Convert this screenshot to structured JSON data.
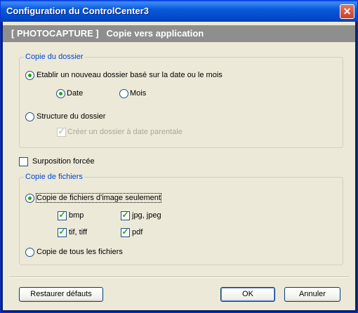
{
  "window": {
    "title": "Configuration du ControlCenter3"
  },
  "banner": {
    "text": "[ PHOTOCAPTURE ]   Copie vers application"
  },
  "folder_group": {
    "legend": "Copie du dossier",
    "option_new_folder": "Etablir un nouveau dossier basé sur la date ou le mois",
    "option_date": "Date",
    "option_month": "Mois",
    "option_structure": "Structure du dossier",
    "option_parent_date": "Créer un dossier à date parentale"
  },
  "overwrite": {
    "label": "Surposition forcée",
    "checked": false
  },
  "files_group": {
    "legend": "Copie de fichiers",
    "option_images_only": "Copie de fichiers d'image seulement",
    "types": {
      "bmp": "bmp",
      "jpg": "jpg, jpeg",
      "tif": "tif, tiff",
      "pdf": "pdf"
    },
    "option_all_files": "Copie de tous les fichiers"
  },
  "buttons": {
    "restore": "Restaurer défauts",
    "ok": "OK",
    "cancel": "Annuler"
  },
  "icons": {
    "close": "close-icon",
    "check": "check-icon"
  }
}
